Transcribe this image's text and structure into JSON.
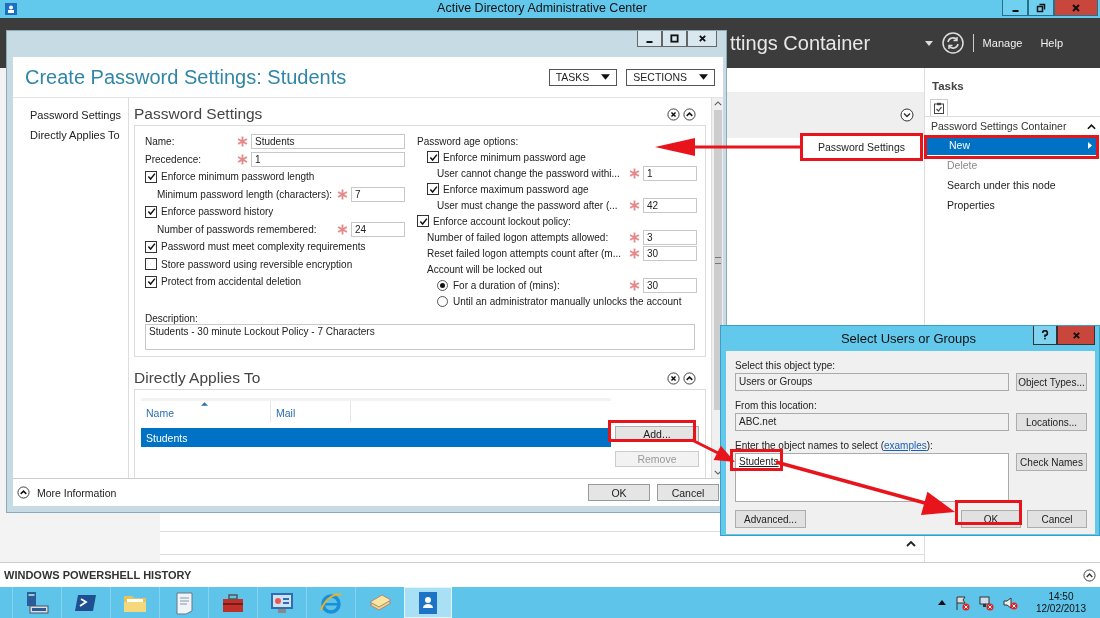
{
  "app": {
    "title": "Active Directory Administrative Center",
    "header_title": "ttings Container",
    "nav": [
      "Manage",
      "Help"
    ]
  },
  "tasks": {
    "heading": "Tasks",
    "section": "Password Settings Container",
    "items": [
      {
        "label": "New",
        "selected": true,
        "disabled": false,
        "submenu": [
          "Password Settings"
        ]
      },
      {
        "label": "Delete",
        "selected": false,
        "disabled": true
      },
      {
        "label": "Search under this node",
        "selected": false,
        "disabled": false
      },
      {
        "label": "Properties",
        "selected": false,
        "disabled": false
      }
    ]
  },
  "dialog": {
    "title": "Create Password Settings: Students",
    "menus": [
      "TASKS",
      "SECTIONS"
    ],
    "nav": [
      "Password Settings",
      "Directly Applies To"
    ],
    "password_settings": {
      "heading": "Password Settings",
      "left": [
        {
          "kind": "field",
          "label": "Name:",
          "required": true,
          "value": "Students"
        },
        {
          "kind": "field",
          "label": "Precedence:",
          "required": true,
          "value": "1"
        },
        {
          "kind": "check",
          "label": "Enforce minimum password length",
          "checked": true,
          "children": [
            {
              "kind": "field",
              "label": "Minimum password length (characters):",
              "required": true,
              "value": "7"
            }
          ]
        },
        {
          "kind": "check",
          "label": "Enforce password history",
          "checked": true,
          "children": [
            {
              "kind": "field",
              "label": "Number of passwords remembered:",
              "required": true,
              "value": "24"
            }
          ]
        },
        {
          "kind": "check",
          "label": "Password must meet complexity requirements",
          "checked": true
        },
        {
          "kind": "check",
          "label": "Store password using reversible encryption",
          "checked": false
        },
        {
          "kind": "check",
          "label": "Protect from accidental deletion",
          "checked": true
        }
      ],
      "right": [
        {
          "kind": "label",
          "label": "Password age options:",
          "children": [
            {
              "kind": "check",
              "label": "Enforce minimum password age",
              "checked": true,
              "children": [
                {
                  "kind": "field",
                  "label": "User cannot change the password withi...",
                  "required": true,
                  "value": "1"
                }
              ]
            },
            {
              "kind": "check",
              "label": "Enforce maximum password age",
              "checked": true,
              "children": [
                {
                  "kind": "field",
                  "label": "User must change the password after (...",
                  "required": true,
                  "value": "42"
                }
              ]
            }
          ]
        },
        {
          "kind": "check",
          "label": "Enforce account lockout policy:",
          "checked": true,
          "children": [
            {
              "kind": "field",
              "label": "Number of failed logon attempts allowed:",
              "required": true,
              "value": "3"
            },
            {
              "kind": "field",
              "label": "Reset failed logon attempts count after (m...",
              "required": true,
              "value": "30"
            },
            {
              "kind": "label",
              "label": "Account will be locked out",
              "children": [
                {
                  "kind": "radio",
                  "label": "For a duration of (mins):",
                  "selected": true,
                  "required": true,
                  "value": "30"
                },
                {
                  "kind": "radio",
                  "label": "Until an administrator manually unlocks the account",
                  "selected": false
                }
              ]
            }
          ]
        }
      ],
      "description_label": "Description:",
      "description": "Students - 30 minute Lockout Policy - 7 Characters"
    },
    "applies_to": {
      "heading": "Directly Applies To",
      "columns": [
        {
          "label": "Name",
          "sorted": true
        },
        {
          "label": "Mail",
          "sorted": false
        }
      ],
      "rows": [
        {
          "cells": [
            "Students"
          ],
          "selected": true
        }
      ],
      "buttons": [
        {
          "label": "Add...",
          "disabled": false
        },
        {
          "label": "Remove",
          "disabled": true
        }
      ]
    },
    "more_info": "More Information",
    "buttons": [
      "OK",
      "Cancel"
    ]
  },
  "select_dialog": {
    "title": "Select Users or Groups",
    "object_type_label": "Select this object type:",
    "object_type": "Users or Groups",
    "object_types_button": "Object Types...",
    "location_label": "From this location:",
    "location": "ABC.net",
    "locations_button": "Locations...",
    "names_label_before": "Enter the object names to select (",
    "names_link": "examples",
    "names_label_after": "):",
    "names": "Students",
    "check_names_button": "Check Names",
    "advanced_button": "Advanced...",
    "buttons": [
      "OK",
      "Cancel"
    ]
  },
  "powershell": {
    "title": "WINDOWS POWERSHELL HISTORY"
  },
  "taskbar": {
    "apps": [
      {
        "kind": "server",
        "selected": false
      },
      {
        "kind": "terminal",
        "selected": false
      },
      {
        "kind": "folder",
        "selected": false
      },
      {
        "kind": "notepad",
        "selected": false
      },
      {
        "kind": "toolbox",
        "selected": false
      },
      {
        "kind": "panel",
        "selected": false
      },
      {
        "kind": "browser",
        "selected": false
      },
      {
        "kind": "papers",
        "selected": false
      },
      {
        "kind": "contacts",
        "selected": true
      }
    ],
    "time": "14:50",
    "date": "12/02/2013"
  }
}
